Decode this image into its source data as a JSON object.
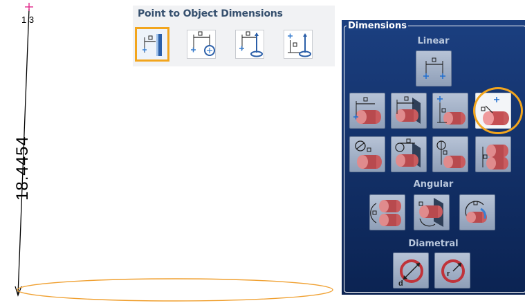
{
  "drawing": {
    "point_label": "1 3",
    "dimension_value": "18.4454",
    "line_color": "#000000",
    "ellipse_color": "#f0a030",
    "marker_color": "#e0288a"
  },
  "point_to_object": {
    "title": "Point to Object Dimensions",
    "buttons": [
      {
        "icon": "point-to-plane-dimension-icon",
        "selected": true
      },
      {
        "icon": "point-to-circle-center-dimension-icon",
        "selected": false
      },
      {
        "icon": "point-to-circle-top-dimension-icon",
        "selected": false
      },
      {
        "icon": "point-to-circle-vertical-dimension-icon",
        "selected": false
      }
    ]
  },
  "dimensions_panel": {
    "title": "Dimensions",
    "sections": {
      "linear": "Linear",
      "angular": "Angular",
      "diametral": "Diametral"
    },
    "diameter_symbol": "d",
    "radius_symbol": "r",
    "selected_button": "linear-point-to-cylinder",
    "accent_color": "#f2a51d"
  }
}
